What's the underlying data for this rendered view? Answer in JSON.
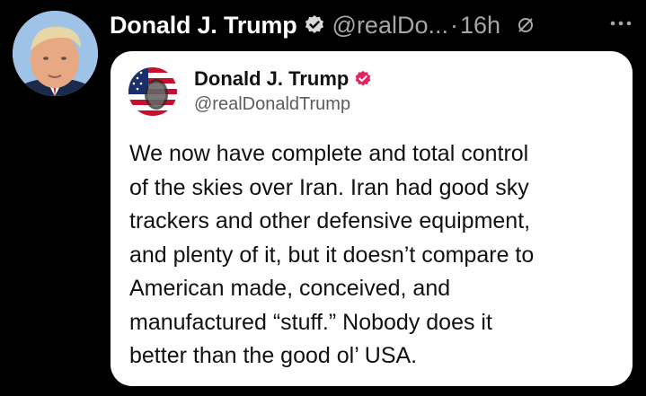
{
  "post": {
    "author_name": "Donald J. Trump",
    "author_handle": "@realDo...",
    "separator": "·",
    "time": "16h",
    "avatar_icon": "trump-avatar",
    "verified_icon": "verified-badge-icon",
    "status_icon": "muted-circle-icon",
    "more_icon": "more-options-icon"
  },
  "embedded_card": {
    "author_name": "Donald J. Trump",
    "author_handle": "@realDonaldTrump",
    "avatar_icon": "flag-portrait-avatar",
    "verified_icon": "verified-badge-red-icon",
    "lines": [
      "We now have complete and total control",
      "of the skies over Iran. Iran had good sky",
      "trackers and other defensive equipment,",
      "and plenty of it, but it doesn’t compare to",
      "American made, conceived, and",
      "manufactured “stuff.” Nobody does it",
      "better than the good ol’ USA."
    ]
  },
  "colors": {
    "background": "#000000",
    "card": "#ffffff",
    "verified_blue": "#1d9bf0",
    "verified_red": "#e0245e",
    "muted_text": "#a7a7a7"
  }
}
